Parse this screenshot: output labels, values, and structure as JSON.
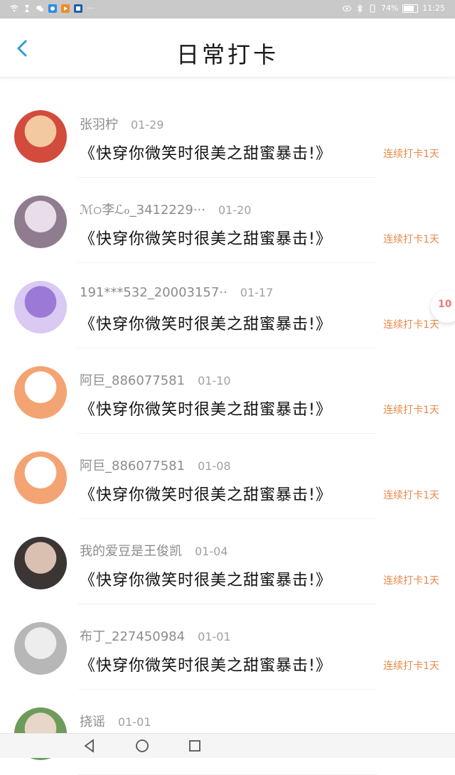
{
  "status_bar": {
    "battery": "74%",
    "time": "11:25",
    "icons_left": [
      "wifi-icon",
      "hourglass-icon",
      "wechat-icon",
      "qq-icon",
      "message-icon",
      "calendar-icon",
      "more-icon"
    ],
    "icons_right": [
      "eye-icon",
      "bluetooth-icon",
      "mute-icon"
    ]
  },
  "header": {
    "title": "日常打卡"
  },
  "items": [
    {
      "name": "张羽柠",
      "date": "01-29",
      "book": "《快穿你微笑时很美之甜蜜暴击!》",
      "streak": "连续打卡1天",
      "avatar_color": "#d24b3d",
      "avatar_color2": "#f3c9a1"
    },
    {
      "name": "ℳ੦李ℒℴ_3412229···",
      "date": "01-20",
      "book": "《快穿你微笑时很美之甜蜜暴击!》",
      "streak": "连续打卡1天",
      "avatar_color": "#8f7c8f",
      "avatar_color2": "#eaddea"
    },
    {
      "name": "191***532_20003157··",
      "date": "01-17",
      "book": "《快穿你微笑时很美之甜蜜暴击!》",
      "streak": "连续打卡1天",
      "avatar_color": "#d9c9f3",
      "avatar_color2": "#9b79d6"
    },
    {
      "name": "阿巨_886077581",
      "date": "01-10",
      "book": "《快穿你微笑时很美之甜蜜暴击!》",
      "streak": "连续打卡1天",
      "avatar_color": "#f4a373",
      "avatar_color2": "#ffffff"
    },
    {
      "name": "阿巨_886077581",
      "date": "01-08",
      "book": "《快穿你微笑时很美之甜蜜暴击!》",
      "streak": "连续打卡1天",
      "avatar_color": "#f4a373",
      "avatar_color2": "#ffffff"
    },
    {
      "name": "我的爱豆是王俊凯",
      "date": "01-04",
      "book": "《快穿你微笑时很美之甜蜜暴击!》",
      "streak": "连续打卡1天",
      "avatar_color": "#3b3533",
      "avatar_color2": "#d9c0b0"
    },
    {
      "name": "布丁_227450984",
      "date": "01-01",
      "book": "《快穿你微笑时很美之甜蜜暴击!》",
      "streak": "连续打卡1天",
      "avatar_color": "#b7b7b7",
      "avatar_color2": "#ededed"
    },
    {
      "name": "挠谣",
      "date": "01-01",
      "book": "",
      "streak": "",
      "avatar_color": "#6e9b5a",
      "avatar_color2": "#e8d6c8"
    }
  ],
  "floating_badge": {
    "text": "10"
  },
  "nav": [
    "back-triangle-icon",
    "home-circle-icon",
    "recent-square-icon"
  ]
}
